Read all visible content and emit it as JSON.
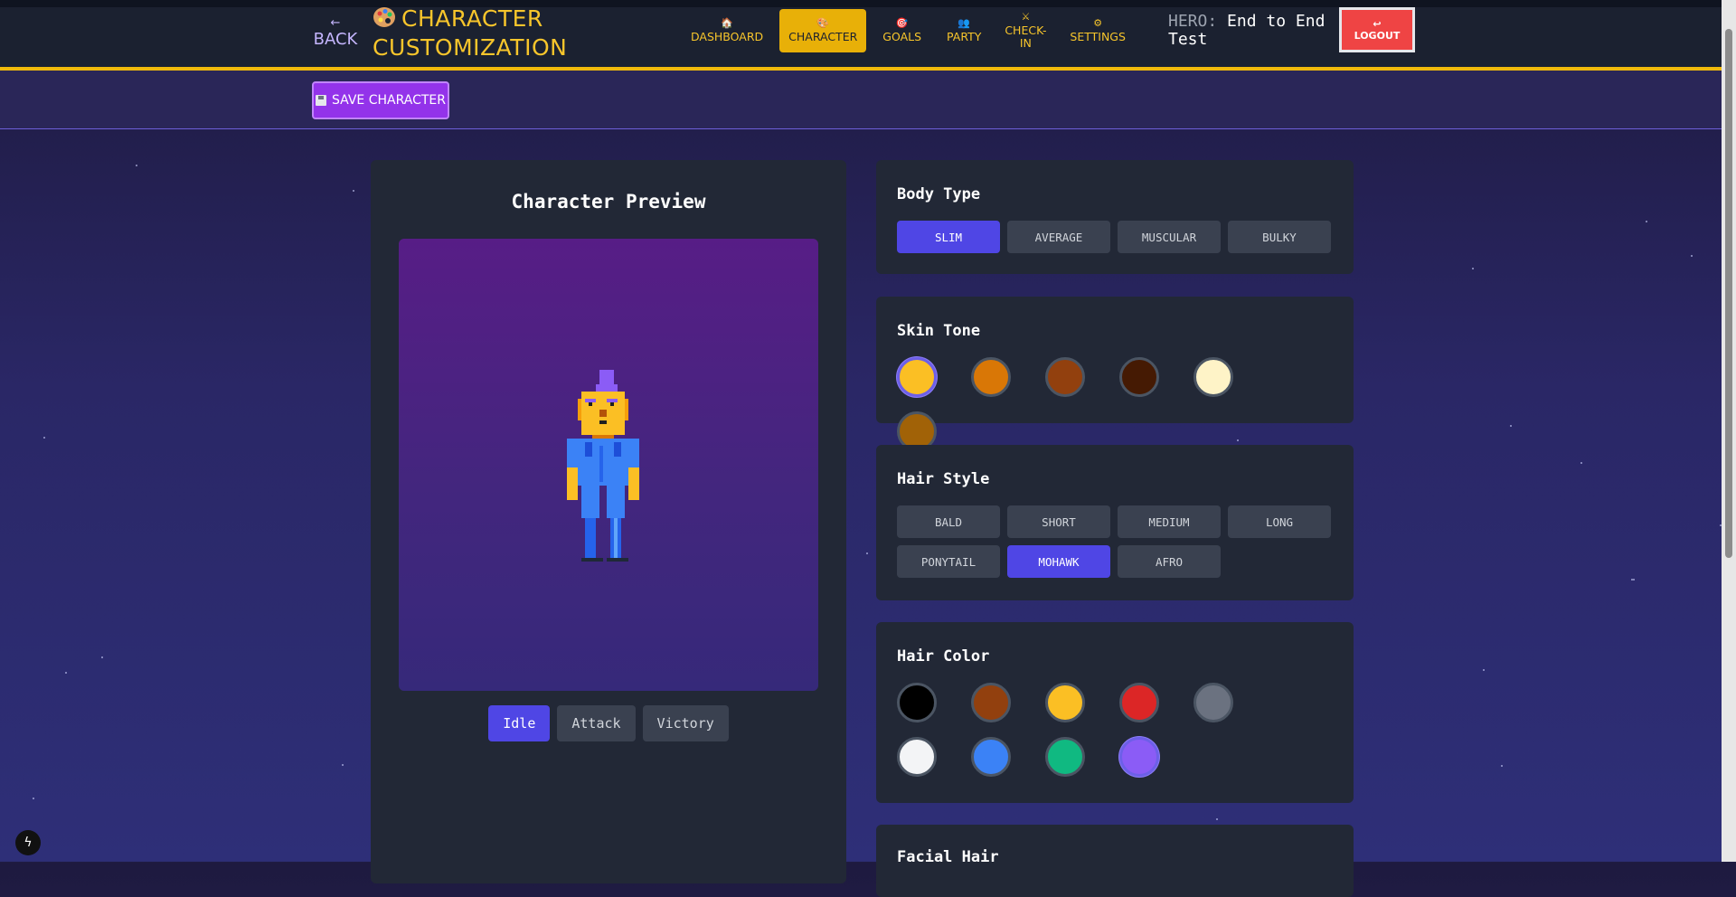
{
  "header": {
    "back_arrow": "←",
    "back_label": "BACK",
    "title_line1": "CHARACTER",
    "title_line2": "CUSTOMIZATION",
    "nav": [
      {
        "icon": "🏠",
        "label": "DASHBOARD"
      },
      {
        "icon": "🎨",
        "label": "CHARACTER"
      },
      {
        "icon": "🎯",
        "label": "GOALS"
      },
      {
        "icon": "👥",
        "label": "PARTY"
      },
      {
        "icon": "⚔",
        "label": "CHECK-IN"
      },
      {
        "icon": "⚙",
        "label": "SETTINGS"
      }
    ],
    "active_nav": "CHARACTER",
    "hero_label": "HERO:",
    "hero_name": "End to End Test",
    "logout_icon": "↩",
    "logout_label": "LOGOUT"
  },
  "toolbar": {
    "save_label": "SAVE CHARACTER"
  },
  "preview": {
    "title": "Character Preview",
    "animations": [
      "Idle",
      "Attack",
      "Victory"
    ],
    "active_animation": "Idle"
  },
  "body_type": {
    "title": "Body Type",
    "options": [
      "SLIM",
      "AVERAGE",
      "MUSCULAR",
      "BULKY"
    ],
    "selected": "SLIM"
  },
  "skin_tone": {
    "title": "Skin Tone",
    "colors": [
      "#fbbf24",
      "#d97706",
      "#92400e",
      "#451a03",
      "#fef3c7",
      "#a16207"
    ],
    "selected_index": 0
  },
  "hair_style": {
    "title": "Hair Style",
    "options": [
      "BALD",
      "SHORT",
      "MEDIUM",
      "LONG",
      "PONYTAIL",
      "MOHAWK",
      "AFRO"
    ],
    "selected": "MOHAWK"
  },
  "hair_color": {
    "title": "Hair Color",
    "colors": [
      "#000000",
      "#92400e",
      "#fbbf24",
      "#dc2626",
      "#6b7280",
      "#f3f4f6",
      "#3b82f6",
      "#10b981",
      "#8b5cf6"
    ],
    "selected_index": 8
  },
  "facial_hair": {
    "title": "Facial Hair"
  },
  "misc": {
    "dev_icon": "ϟ"
  }
}
